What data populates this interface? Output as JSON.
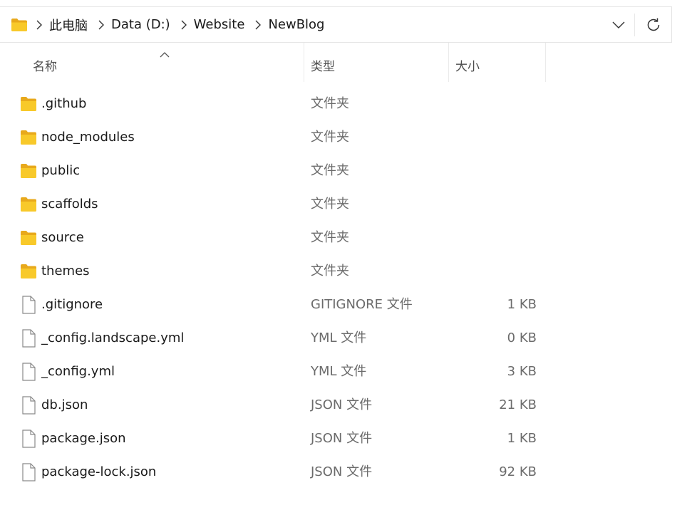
{
  "address_bar": {
    "breadcrumbs": [
      "此电脑",
      "Data (D:)",
      "Website",
      "NewBlog"
    ],
    "folder_icon": "folder-icon",
    "dropdown_icon": "chevron-down-icon",
    "refresh_icon": "refresh-icon"
  },
  "columns": {
    "name": "名称",
    "type": "类型",
    "size": "大小",
    "sort_icon": "sort-ascending-icon"
  },
  "colors": {
    "folder": "#F8C92A",
    "text": "#1A1A1A",
    "secondary_text": "#6B6B6B"
  },
  "rows": [
    {
      "name": ".github",
      "type": "文件夹",
      "size": "",
      "icon": "folder-icon"
    },
    {
      "name": "node_modules",
      "type": "文件夹",
      "size": "",
      "icon": "folder-icon"
    },
    {
      "name": "public",
      "type": "文件夹",
      "size": "",
      "icon": "folder-icon"
    },
    {
      "name": "scaffolds",
      "type": "文件夹",
      "size": "",
      "icon": "folder-icon"
    },
    {
      "name": "source",
      "type": "文件夹",
      "size": "",
      "icon": "folder-icon"
    },
    {
      "name": "themes",
      "type": "文件夹",
      "size": "",
      "icon": "folder-icon"
    },
    {
      "name": ".gitignore",
      "type": "GITIGNORE 文件",
      "size": "1 KB",
      "icon": "file-icon"
    },
    {
      "name": "_config.landscape.yml",
      "type": "YML 文件",
      "size": "0 KB",
      "icon": "file-icon"
    },
    {
      "name": "_config.yml",
      "type": "YML 文件",
      "size": "3 KB",
      "icon": "file-icon"
    },
    {
      "name": "db.json",
      "type": "JSON 文件",
      "size": "21 KB",
      "icon": "file-icon"
    },
    {
      "name": "package.json",
      "type": "JSON 文件",
      "size": "1 KB",
      "icon": "file-icon"
    },
    {
      "name": "package-lock.json",
      "type": "JSON 文件",
      "size": "92 KB",
      "icon": "file-icon"
    }
  ]
}
